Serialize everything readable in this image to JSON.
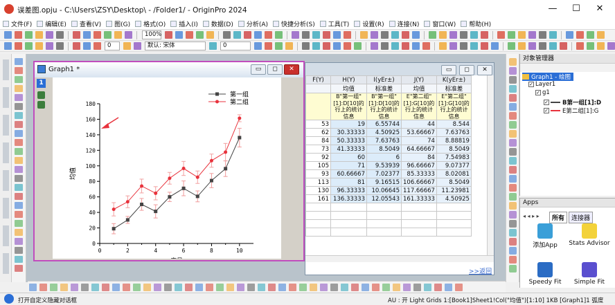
{
  "window": {
    "title": "误差图.opju - C:\\Users\\ZSY\\Desktop\\ - /Folder1/ - OriginPro 2024",
    "min": "—",
    "max": "☐",
    "close": "✕"
  },
  "menus": [
    "文件(F)",
    "编辑(E)",
    "查看(V)",
    "图(G)",
    "格式(O)",
    "插入(I)",
    "数据(D)",
    "分析(A)",
    "快捷分析(S)",
    "工具(T)",
    "设置(R)",
    "连接(N)",
    "窗口(W)",
    "帮助(H)"
  ],
  "toolbar": {
    "zoom": "100%",
    "font_size": "0",
    "font_name": "默认: 宋体",
    "font_size2": "0"
  },
  "graph": {
    "title": "Graph1 *",
    "layer": "1"
  },
  "workbook": {
    "columns": [
      {
        "label": "F(Y)",
        "name": ""
      },
      {
        "label": "H(Y)",
        "name": "均值"
      },
      {
        "label": "I(yEr±)",
        "name": "标准差"
      },
      {
        "label": "J(Y)",
        "name": "均值"
      },
      {
        "label": "K(yEr±)",
        "name": "标准差"
      }
    ],
    "comments": [
      "",
      "B\"第一组\"[1]:D[10]的行上的统计信息",
      "B\"第一组\"[1]:D[10]的行上的统计信息",
      "E\"第二组\"[1]:G[10]的行上的统计信息",
      "E\"第二组\"[1]:G[10]的行上的统计信息"
    ],
    "rows": [
      [
        "53",
        "19",
        "6.55744",
        "44",
        "8.544"
      ],
      [
        "62",
        "30.33333",
        "4.50925",
        "53.66667",
        "7.63763"
      ],
      [
        "84",
        "50.33333",
        "7.63763",
        "74",
        "8.88819"
      ],
      [
        "73",
        "41.33333",
        "8.5049",
        "64.66667",
        "8.5049"
      ],
      [
        "92",
        "60",
        "6",
        "84",
        "7.54983"
      ],
      [
        "105",
        "71",
        "9.53939",
        "96.66667",
        "9.07377"
      ],
      [
        "93",
        "60.66667",
        "7.02377",
        "85.33333",
        "8.02081"
      ],
      [
        "113",
        "81",
        "9.16515",
        "106.66667",
        "8.5049"
      ],
      [
        "130",
        "96.33333",
        "10.06645",
        "117.66667",
        "11.23981"
      ],
      [
        "161",
        "136.33333",
        "12.05543",
        "161.33333",
        "4.50925"
      ]
    ],
    "back_link": ">>返回"
  },
  "chart_data": {
    "type": "line",
    "title": "",
    "xlabel": "序号",
    "ylabel": "均值",
    "xlim": [
      0,
      11
    ],
    "ylim": [
      0,
      180
    ],
    "xticks": [
      0,
      2,
      4,
      6,
      8,
      10
    ],
    "yticks": [
      0,
      20,
      40,
      60,
      80,
      100,
      120,
      140,
      160,
      180
    ],
    "x": [
      1,
      2,
      3,
      4,
      5,
      6,
      7,
      8,
      9,
      10
    ],
    "series": [
      {
        "name": "第一组",
        "color": "#444444",
        "marker": "square",
        "values": [
          19,
          30.33333,
          50.33333,
          41.33333,
          60,
          71,
          60.66667,
          81,
          96.33333,
          136.33333
        ],
        "errors": [
          6.55744,
          4.50925,
          7.63763,
          8.5049,
          6,
          9.53939,
          7.02377,
          9.16515,
          10.06645,
          12.05543
        ]
      },
      {
        "name": "第二组",
        "color": "#e8323c",
        "marker": "circle",
        "values": [
          44,
          53.66667,
          74,
          64.66667,
          84,
          96.66667,
          85.33333,
          106.66667,
          117.66667,
          161.33333
        ],
        "errors": [
          8.544,
          7.63763,
          8.88819,
          8.5049,
          7.54983,
          9.07377,
          8.02081,
          8.5049,
          11.23981,
          4.50925
        ]
      }
    ],
    "legend": "top-right",
    "grid": false
  },
  "object_manager": {
    "title": "对象管理器",
    "graph": "Graph1 - 绘图",
    "layer": "Layer1",
    "group": "g1",
    "plots": [
      "B第一组[1]:D",
      "E第二组[1]:G"
    ]
  },
  "apps": {
    "title": "Apps",
    "tab_all": "所有",
    "tab_connector": "连接器",
    "items": [
      "添加App",
      "Stats Advisor",
      "Speedy Fit",
      "Simple Fit"
    ]
  },
  "status": {
    "left": "打开自定义隐藏对话框",
    "right": "AU : 开  Light Grids  1:[Book1]Sheet1!Col(\"均值\")[1:10]  1KB  [Graph1]1  弧度"
  },
  "colors": {
    "accent": "#2a6ed6",
    "graph_border": "#c04dbd",
    "close_red": "#c9302c"
  }
}
